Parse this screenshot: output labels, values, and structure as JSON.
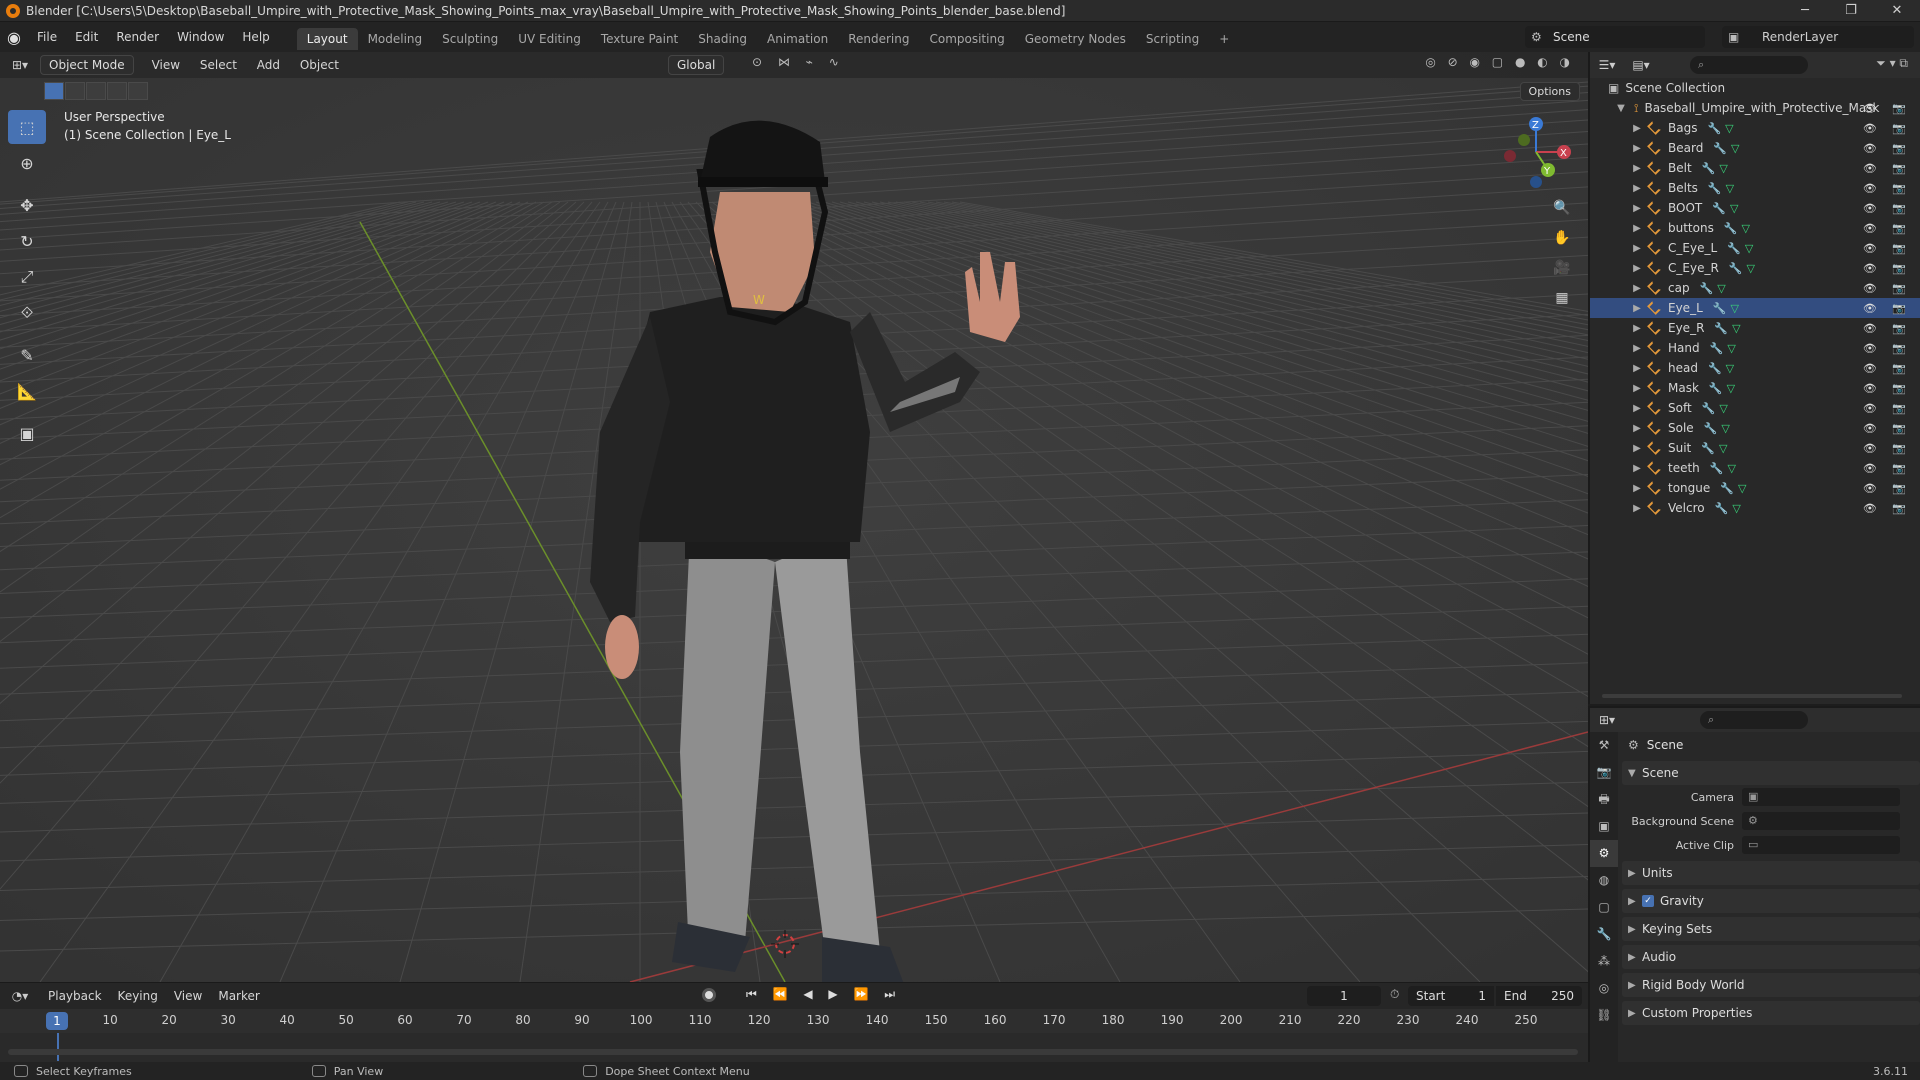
{
  "titlebar": {
    "title": "Blender [C:\\Users\\5\\Desktop\\Baseball_Umpire_with_Protective_Mask_Showing_Points_max_vray\\Baseball_Umpire_with_Protective_Mask_Showing_Points_blender_base.blend]",
    "min": "─",
    "max": "❐",
    "close": "✕"
  },
  "menu": [
    "File",
    "Edit",
    "Render",
    "Window",
    "Help"
  ],
  "workspaces": [
    "Layout",
    "Modeling",
    "Sculpting",
    "UV Editing",
    "Texture Paint",
    "Shading",
    "Animation",
    "Rendering",
    "Compositing",
    "Geometry Nodes",
    "Scripting"
  ],
  "active_workspace": "Layout",
  "scene_name": "Scene",
  "render_layer": "RenderLayer",
  "viewport": {
    "mode": "Object Mode",
    "menu": [
      "View",
      "Select",
      "Add",
      "Object"
    ],
    "transform_orientation": "Global",
    "options_label": "Options",
    "info_line1": "User Perspective",
    "info_line2": "(1) Scene Collection | Eye_L",
    "gizmo": {
      "x": "X",
      "y": "Y",
      "z": "Z"
    }
  },
  "timeline": {
    "menu": [
      "Playback",
      "Keying",
      "View",
      "Marker"
    ],
    "current_frame": "1",
    "start_label": "Start",
    "start_value": "1",
    "end_label": "End",
    "end_value": "250",
    "ruler": [
      "1",
      "10",
      "20",
      "30",
      "40",
      "50",
      "60",
      "70",
      "80",
      "90",
      "100",
      "110",
      "120",
      "130",
      "140",
      "150",
      "160",
      "170",
      "180",
      "190",
      "200",
      "210",
      "220",
      "230",
      "240",
      "250"
    ]
  },
  "statusbar": {
    "hint1": "Select Keyframes",
    "hint2": "Pan View",
    "hint3": "Dope Sheet Context Menu",
    "version": "3.6.11"
  },
  "outliner": {
    "root": "Scene Collection",
    "collection": "Baseball_Umpire_with_Protective_Mask",
    "objects": [
      "Bags",
      "Beard",
      "Belt",
      "Belts",
      "BOOT",
      "buttons",
      "C_Eye_L",
      "C_Eye_R",
      "cap",
      "Eye_L",
      "Eye_R",
      "Hand",
      "head",
      "Mask",
      "Soft",
      "Sole",
      "Suit",
      "teeth",
      "tongue",
      "Velcro"
    ],
    "selected": "Eye_L"
  },
  "properties": {
    "breadcrumb": "Scene",
    "panel": "Scene",
    "camera_label": "Camera",
    "bg_scene_label": "Background Scene",
    "active_clip_label": "Active Clip",
    "subpanels": [
      "Units",
      "Gravity",
      "Keying Sets",
      "Audio",
      "Rigid Body World",
      "Custom Properties"
    ],
    "gravity_checked": true
  },
  "colors": {
    "accent": "#4772b3",
    "x_axis": "#c9414f",
    "y_axis": "#7fba30",
    "z_axis": "#3a7ad6"
  }
}
